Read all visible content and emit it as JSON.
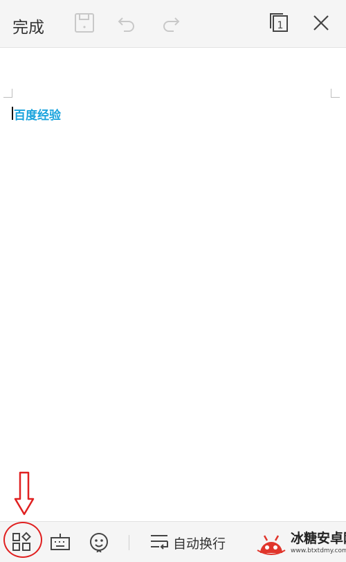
{
  "toolbar": {
    "done_label": "完成",
    "icons": [
      "save-icon",
      "undo-icon",
      "redo-icon",
      "page-view-icon",
      "close-icon"
    ],
    "page_indicator": "1"
  },
  "document": {
    "text": "百度经验",
    "text_color": "#1aa3dd"
  },
  "bottom_toolbar": {
    "icons": [
      "apps-icon",
      "keyboard-icon",
      "emoji-icon",
      "wrap-lines-icon"
    ],
    "wrap_label": "自动换行"
  },
  "annotation": {
    "color": "#e02020"
  },
  "watermark": {
    "name": "冰糖安卓网",
    "url": "www.btxtdmy.com"
  }
}
